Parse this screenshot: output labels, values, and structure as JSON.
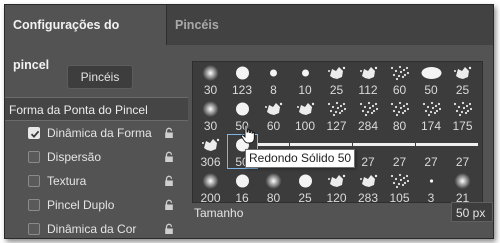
{
  "tabs": [
    "Configurações do pincel",
    "Pincéis"
  ],
  "brushes_button": "Pincéis",
  "tip_shape_header": "Forma da Ponta do Pincel",
  "options": [
    {
      "label": "Dinâmica da Forma",
      "checked": true
    },
    {
      "label": "Dispersão",
      "checked": false
    },
    {
      "label": "Textura",
      "checked": false
    },
    {
      "label": "Pincel Duplo",
      "checked": false
    },
    {
      "label": "Dinâmica da Cor",
      "checked": false
    }
  ],
  "brush_grid": {
    "rows": [
      [
        "30",
        "123",
        "8",
        "10",
        "25",
        "112",
        "60",
        "50",
        "25"
      ],
      [
        "30",
        "50",
        "60",
        "100",
        "127",
        "284",
        "80",
        "174",
        "175"
      ],
      [
        "306",
        "50",
        "27",
        "27",
        "27",
        "27",
        "27",
        "27",
        "27"
      ],
      [
        "200",
        "16",
        "80",
        "25",
        "120",
        "283",
        "105",
        "3",
        "21"
      ]
    ],
    "selected": "row 2, column 2"
  },
  "tooltip": "Redondo Sólido 50",
  "size_label": "Tamanho",
  "size_value": "50 px",
  "colors": {
    "panel": "#535353",
    "tab_bar": "#424242",
    "grid_bg": "#3c3c3c",
    "selection": "#7fb6e6"
  },
  "icons": [
    "checkbox-check-icon",
    "lock-icon",
    "brush-thumbnail-icon",
    "hand-pointer-icon"
  ]
}
